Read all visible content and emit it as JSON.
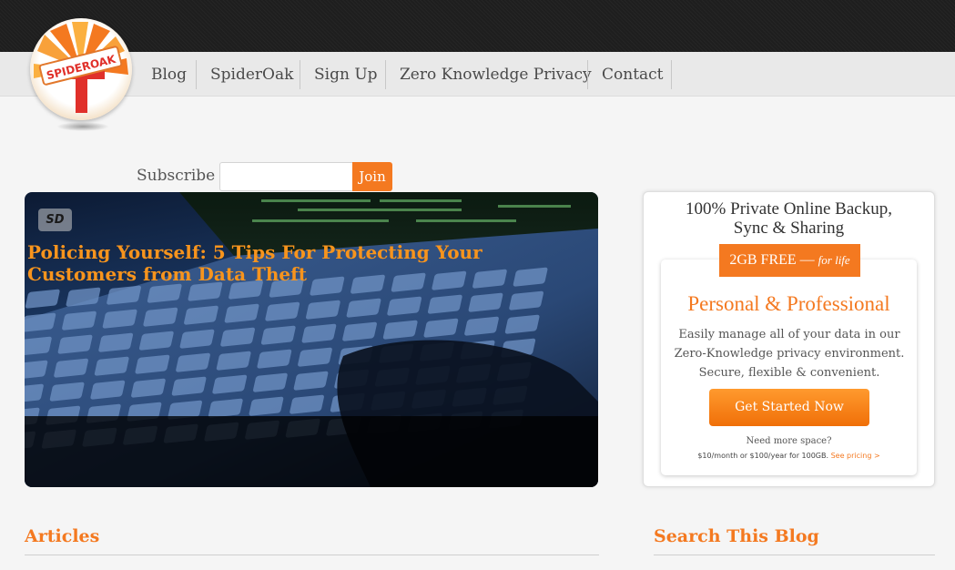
{
  "logo": {
    "text": "SPIDEROAK",
    "icon": "spideroak-logo-icon"
  },
  "nav": {
    "items": [
      {
        "label": "Blog"
      },
      {
        "label": "SpiderOak"
      },
      {
        "label": "Sign Up"
      },
      {
        "label": "Zero Knowledge Privacy"
      },
      {
        "label": "Contact"
      }
    ]
  },
  "subscribe": {
    "label": "Subscribe",
    "input_value": "",
    "input_placeholder": "",
    "button_label": "Join"
  },
  "hero": {
    "badge": "SD",
    "title": "Policing Yourself: 5 Tips For Protecting Your Customers from Data Theft"
  },
  "promo": {
    "title_line1": "100% Private Online Backup,",
    "title_line2": "Sync & Sharing",
    "ribbon_main": "2GB FREE —",
    "ribbon_em": "for life",
    "heading": "Personal & Professional",
    "desc_line1": "Easily manage all of your data in our",
    "desc_line2": "Zero-Knowledge privacy environment.",
    "desc_line3": "Secure, flexible & convenient.",
    "button_label": "Get Started Now",
    "need_space": "Need more space?",
    "pricing_text": "$10/month or $100/year for 100GB.",
    "pricing_link": "See pricing >"
  },
  "sections": {
    "articles": "Articles",
    "search": "Search This Blog"
  },
  "colors": {
    "accent": "#f47920",
    "topbar": "#1e1e1e",
    "navbar": "#e9e9e9",
    "background": "#f5f5f5"
  }
}
